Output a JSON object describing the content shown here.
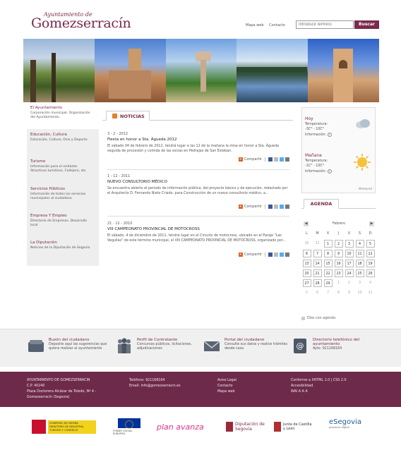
{
  "header": {
    "logo_top": "Ayuntamiento de",
    "logo_main": "Gomezserracín",
    "links": [
      "Mapa web",
      "Contacto"
    ],
    "search_placeholder": "Introducir término",
    "search_button": "Buscar"
  },
  "nav": [
    {
      "title": "El Ayuntamiento",
      "desc": "Corporación municipal. Organización del Ayuntamiento."
    },
    {
      "title": "Educación, Cultura",
      "desc": "Educación, Cultura, Ocio y Deporte"
    },
    {
      "title": "Turismo",
      "desc": "Información para el visitante. Atractivos turísticos, Callejero, etc"
    },
    {
      "title": "Servicios Públicos",
      "desc": "Información de todos los servicios municipales al ciudadano"
    },
    {
      "title": "Empresa Y Empleo",
      "desc": "Directorio de Empresas. Desarrollo local"
    },
    {
      "title": "La Diputación",
      "desc": "Noticias de la Diputación de Segovia"
    }
  ],
  "news": {
    "tab_label": "NOTICIAS",
    "share_label": "Compartir",
    "items": [
      {
        "date": "3 - 2 - 2012",
        "title": "Fiesta en honor a Sta. Águeda 2012",
        "body": "El sábado 04 de febrero de 2012, tendrá lugar a las 12 de la mañana la misa en honor a Sta. Águeda seguida de procesión y comida de las socias en Pedrajas de San Esteban."
      },
      {
        "date": "1 - 12 - 2011",
        "title": "NUEVO CONSULTORIO MÉDICO",
        "body": "Se encuentra abierto el periodo de información pública, del proyecto básico y de ejecución, redactado por el Arquitecto D. Fernando Nieto Criado, para Construcción de un nuevo consultorio médico, a..."
      },
      {
        "date": "21 - 12 - 2010",
        "title": "VIII CAMPEONATO PROVINCIAL DE MOTOCROSS",
        "body": "El sábado, 4 de diciembre de 2011, tendrá lugar en el Circuito de motocross, ubicado en el Paraje \"Las Vegullas\" de este término municipal, el VIII CAMPEONATO PROVINCIAL DE MOTOCROSS, organizado por..."
      }
    ]
  },
  "weather": {
    "today_label": "Hoy",
    "today_temp_label": "Temperatura:",
    "today_temp": "-3C° - 10C°",
    "today_info": "Información:",
    "tomorrow_label": "Mañana",
    "tomorrow_temp_label": "Temperatura:",
    "tomorrow_temp": "-1C° - 10C°",
    "tomorrow_info": "Información:",
    "powered": "Meteored",
    "today_icon": "cloud-icon",
    "tomorrow_icon": "sun-icon"
  },
  "agenda": {
    "tab_label": "AGENDA",
    "month": "Febrero",
    "prev": "◀",
    "next": "▶",
    "weekdays": [
      "L",
      "M",
      "X",
      "J",
      "V",
      "S",
      "D"
    ],
    "weeks": [
      [
        {
          "d": "30",
          "in": false
        },
        {
          "d": "31",
          "in": false
        },
        {
          "d": "1",
          "in": true
        },
        {
          "d": "2",
          "in": true
        },
        {
          "d": "3",
          "in": true
        },
        {
          "d": "4",
          "in": true
        },
        {
          "d": "5",
          "in": true
        }
      ],
      [
        {
          "d": "6",
          "in": true
        },
        {
          "d": "7",
          "in": true
        },
        {
          "d": "8",
          "in": true
        },
        {
          "d": "9",
          "in": true
        },
        {
          "d": "10",
          "in": true
        },
        {
          "d": "11",
          "in": true
        },
        {
          "d": "12",
          "in": true
        }
      ],
      [
        {
          "d": "13",
          "in": true
        },
        {
          "d": "14",
          "in": true
        },
        {
          "d": "15",
          "in": true
        },
        {
          "d": "16",
          "in": true
        },
        {
          "d": "17",
          "in": true
        },
        {
          "d": "18",
          "in": true
        },
        {
          "d": "19",
          "in": true
        }
      ],
      [
        {
          "d": "20",
          "in": true
        },
        {
          "d": "21",
          "in": true
        },
        {
          "d": "22",
          "in": true
        },
        {
          "d": "23",
          "in": true
        },
        {
          "d": "24",
          "in": true
        },
        {
          "d": "25",
          "in": true
        },
        {
          "d": "26",
          "in": true
        }
      ],
      [
        {
          "d": "27",
          "in": true
        },
        {
          "d": "28",
          "in": true
        },
        {
          "d": "29",
          "in": true
        },
        {
          "d": "1",
          "in": false
        },
        {
          "d": "2",
          "in": false
        },
        {
          "d": "3",
          "in": false
        },
        {
          "d": "4",
          "in": false
        }
      ],
      [
        {
          "d": "5",
          "in": false
        },
        {
          "d": "6",
          "in": false
        },
        {
          "d": "7",
          "in": false
        },
        {
          "d": "8",
          "in": false
        },
        {
          "d": "9",
          "in": false
        },
        {
          "d": "10",
          "in": false
        },
        {
          "d": "11",
          "in": false
        }
      ]
    ],
    "legend": "Días con agenda"
  },
  "services": [
    {
      "title": "Buzón del ciudadano",
      "desc": "Deposite aquí las sugerencias que quiera realizar al ayuntamiento",
      "icon": "mailbox-icon"
    },
    {
      "title": "Perfil de Contratante",
      "desc": "Concursos públicos, licitaciones, adjudicaciones",
      "icon": "people-icon"
    },
    {
      "title": "Portal del ciudadano",
      "desc": "Consulte sus datos y realice trámites desde casa",
      "icon": "envelope-icon"
    },
    {
      "title": "Directorio telefónico del ayuntamiento",
      "desc": "Ayto: 921168164",
      "icon": "phonebook-icon"
    }
  ],
  "footer": {
    "col1": [
      "AYUNTAMIENTO DE GOMEZSERRACIN",
      "C.P. 40240",
      "Plaza Doctorera Alcázar de Toledo, Nº 4 -",
      "Gomezserracín (Segovia)"
    ],
    "col2": [
      "Teléfono: 921168164",
      "Email: info@gomezserracin.es"
    ],
    "col3": [
      "Aviso Legal",
      "Contacto",
      "Mapa web"
    ],
    "col4": [
      "Conforme a XHTML 1.0 | CSS 2.0",
      "Accesibilidad",
      "WAI  A A A"
    ]
  },
  "logos": [
    {
      "text": "GOBIERNO DE ESPAÑA",
      "sub": "MINISTERIO DE INDUSTRIA, TURISMO Y COMERCIO"
    },
    {
      "text": "FONDO SOCIAL EUROPEO"
    },
    {
      "text": "plan avanza"
    },
    {
      "text": "Diputación de Segovia"
    },
    {
      "text": "Junta de Castilla y León"
    },
    {
      "text": "eSegovia",
      "sub": "provincia digital"
    }
  ]
}
